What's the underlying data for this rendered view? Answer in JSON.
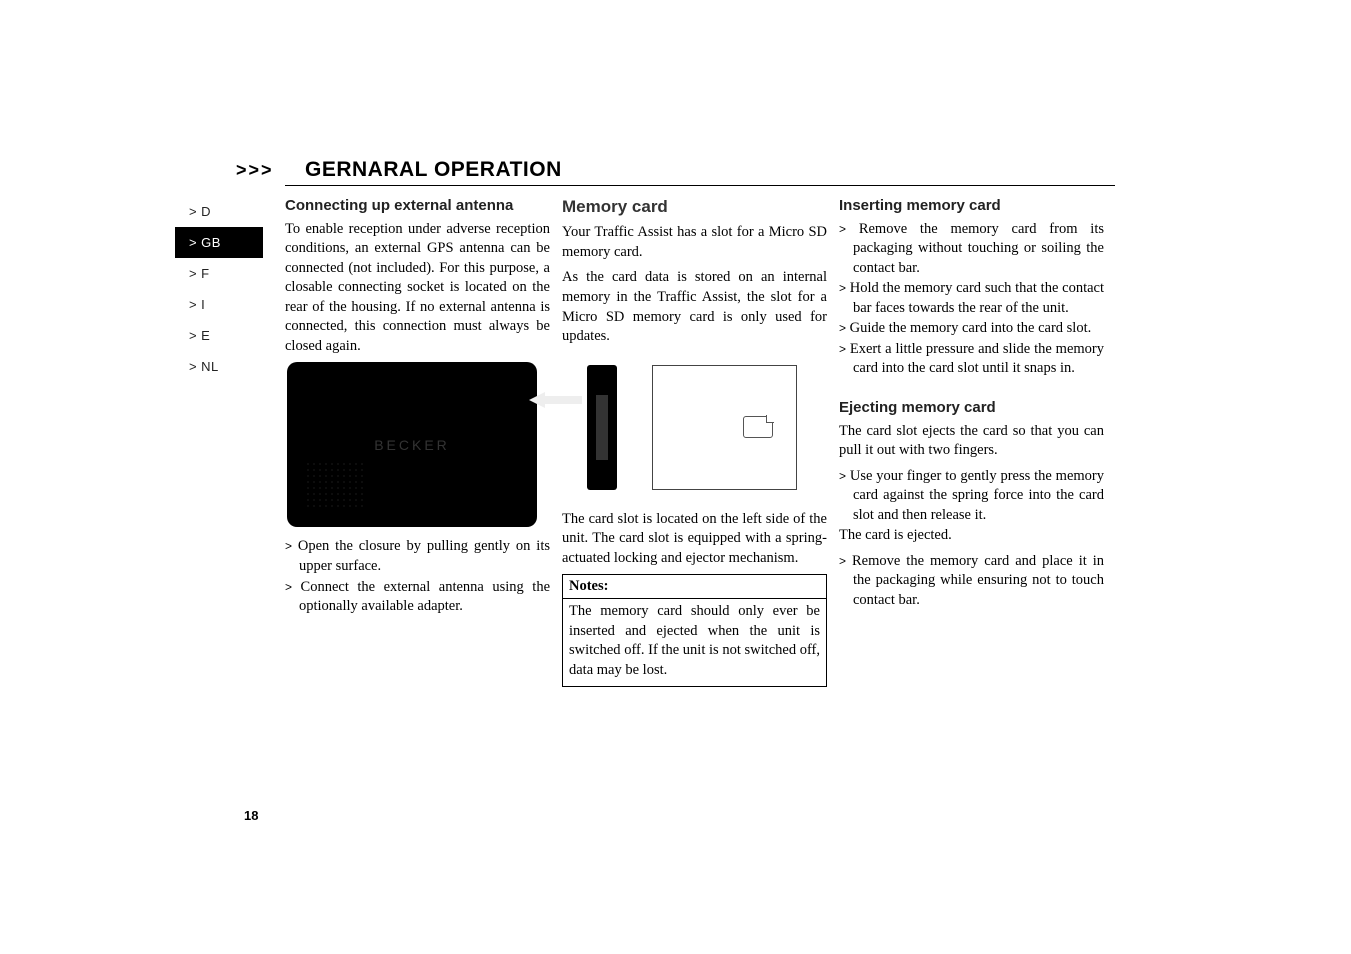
{
  "header": {
    "arrows": ">>>",
    "title": "GERNARAL OPERATION"
  },
  "sidebar": {
    "items": [
      {
        "arrow": ">",
        "label": "D",
        "active": false
      },
      {
        "arrow": ">",
        "label": "GB",
        "active": true
      },
      {
        "arrow": ">",
        "label": "F",
        "active": false
      },
      {
        "arrow": ">",
        "label": "I",
        "active": false
      },
      {
        "arrow": ">",
        "label": "E",
        "active": false
      },
      {
        "arrow": ">",
        "label": "NL",
        "active": false
      }
    ]
  },
  "col1": {
    "heading": "Connecting up external antenna",
    "para1": "To enable reception under adverse reception conditions, an external GPS antenna can be connected (not included). For this purpose, a closable connecting socket is located on the rear of the housing. If no external antenna is connected, this connection must always be closed again.",
    "device_logo": "BECKER",
    "step1": "Open the closure by pulling gently on its upper surface.",
    "step2": "Connect the external antenna using the optionally available adapter."
  },
  "col2": {
    "heading": "Memory card",
    "para1": "Your Traffic Assist has a slot for a Micro SD memory card.",
    "para2": "As the card data is stored on an internal memory in the Traffic Assist, the slot for a Micro SD memory card is only used for updates.",
    "para3": "The card slot is located on the left side of the unit. The card slot is equipped with a spring-actuated locking and ejector mechanism.",
    "notes_label": "Notes:",
    "notes_body": "The memory card should only ever be inserted and ejected when the unit is switched off. If the unit is not switched off, data may be lost."
  },
  "col3": {
    "heading1": "Inserting memory card",
    "i_step1": "Remove the memory card from its packaging without touching or soiling the contact bar.",
    "i_step2": "Hold the memory card such that the contact bar faces towards the rear of the unit.",
    "i_step3": "Guide the memory card into the card slot.",
    "i_step4": "Exert a little pressure and slide the memory card into the card slot until it snaps in.",
    "heading2": "Ejecting memory card",
    "e_para": "The card slot ejects the card so that you can pull it out with two fingers.",
    "e_step1": "Use your finger to gently press the memory card against the spring force into the card slot and then release it.",
    "e_result": "The card is ejected.",
    "e_step2": "Remove the memory card and place it in the packaging while ensuring not to touch contact bar."
  },
  "page_number": "18",
  "list_arrow": ">"
}
